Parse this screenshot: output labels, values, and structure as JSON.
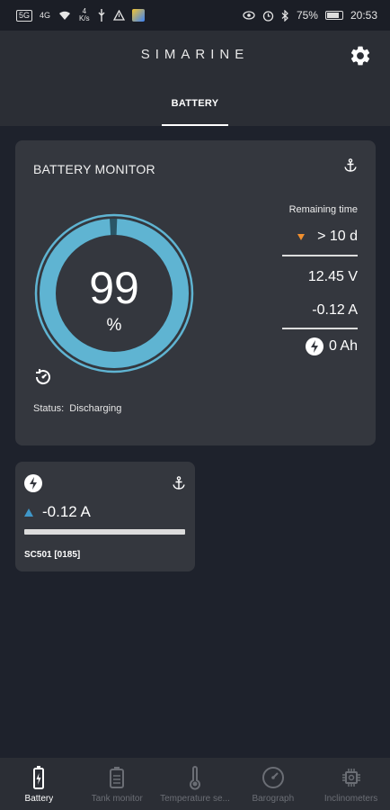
{
  "status_bar": {
    "left_badge": "5G",
    "net_type": "4G",
    "speed_value": "4",
    "speed_unit": "K/s",
    "battery_percent": "75%",
    "time": "20:53"
  },
  "header": {
    "brand": "SIMARINE",
    "tab_label": "BATTERY"
  },
  "battery_monitor": {
    "title": "BATTERY MONITOR",
    "soc_value": "99",
    "soc_unit": "%",
    "soc_fraction": 0.99,
    "status_label": "Status:",
    "status_value": "Discharging",
    "remaining_time_label": "Remaining time",
    "remaining_time_value": "> 10 d",
    "voltage": "12.45 V",
    "current": "-0.12 A",
    "charge": "0 Ah"
  },
  "device": {
    "current": "-0.12 A",
    "name": "SC501 [0185]"
  },
  "bottom_nav": [
    {
      "label": "Battery",
      "icon": "battery-icon",
      "active": true
    },
    {
      "label": "Tank monitor",
      "icon": "tank-icon",
      "active": false
    },
    {
      "label": "Temperature se...",
      "icon": "thermometer-icon",
      "active": false
    },
    {
      "label": "Barograph",
      "icon": "gauge-icon",
      "active": false
    },
    {
      "label": "Inclinometers",
      "icon": "chip-icon",
      "active": false
    }
  ],
  "colors": {
    "background": "#1e222c",
    "card": "#34373e",
    "header": "#2b2e35",
    "gauge": "#5fb4d2",
    "down_arrow": "#f2902f",
    "up_arrow": "#3f97c9",
    "nav_inactive": "#6b6e75"
  }
}
